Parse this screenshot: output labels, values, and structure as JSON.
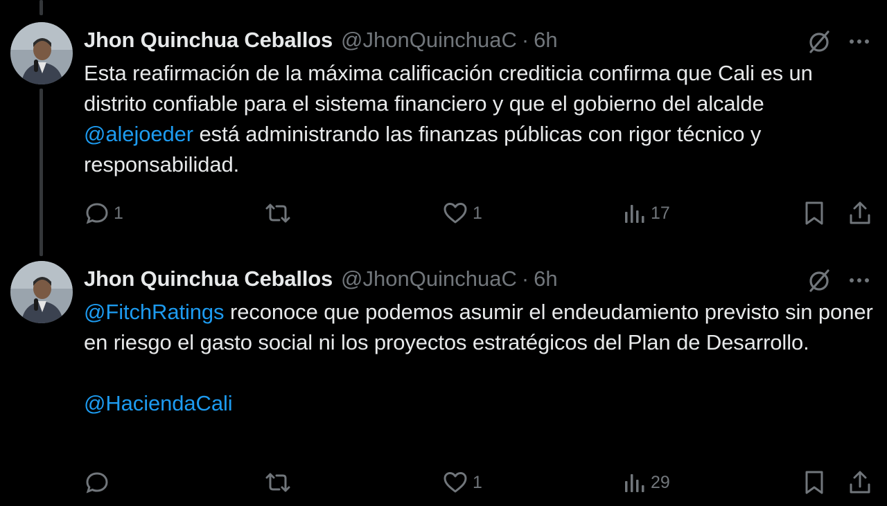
{
  "tweets": [
    {
      "name": "Jhon Quinchua Ceballos",
      "handle": "@JhonQuinchuaC",
      "separator": "·",
      "time": "6h",
      "body": {
        "part1": "Esta reafirmación de la máxima calificación crediticia confirma que Cali es un distrito confiable para el sistema financiero y que el gobierno del alcalde ",
        "mention1": "@alejoeder",
        "part2": " está administrando las finanzas públicas con rigor técnico y responsabilidad."
      },
      "stats": {
        "replies": "1",
        "reposts": "",
        "likes": "1",
        "views": "17"
      }
    },
    {
      "name": "Jhon Quinchua Ceballos",
      "handle": "@JhonQuinchuaC",
      "separator": "·",
      "time": "6h",
      "body": {
        "mention1": "@FitchRatings",
        "part1": " reconoce que podemos asumir el endeudamiento previsto sin poner en riesgo el gasto social ni los proyectos estratégicos del Plan de Desarrollo.",
        "mention2": "@HaciendaCali"
      },
      "stats": {
        "replies": "",
        "reposts": "",
        "likes": "1",
        "views": "29"
      }
    }
  ],
  "icons": [
    "reply-icon",
    "repost-icon",
    "like-icon",
    "views-icon",
    "bookmark-icon",
    "share-icon",
    "grok-icon",
    "more-icon"
  ],
  "colors": {
    "background": "#000000",
    "text": "#e7e9ea",
    "muted": "#71767b",
    "link": "#1d9bf0"
  }
}
